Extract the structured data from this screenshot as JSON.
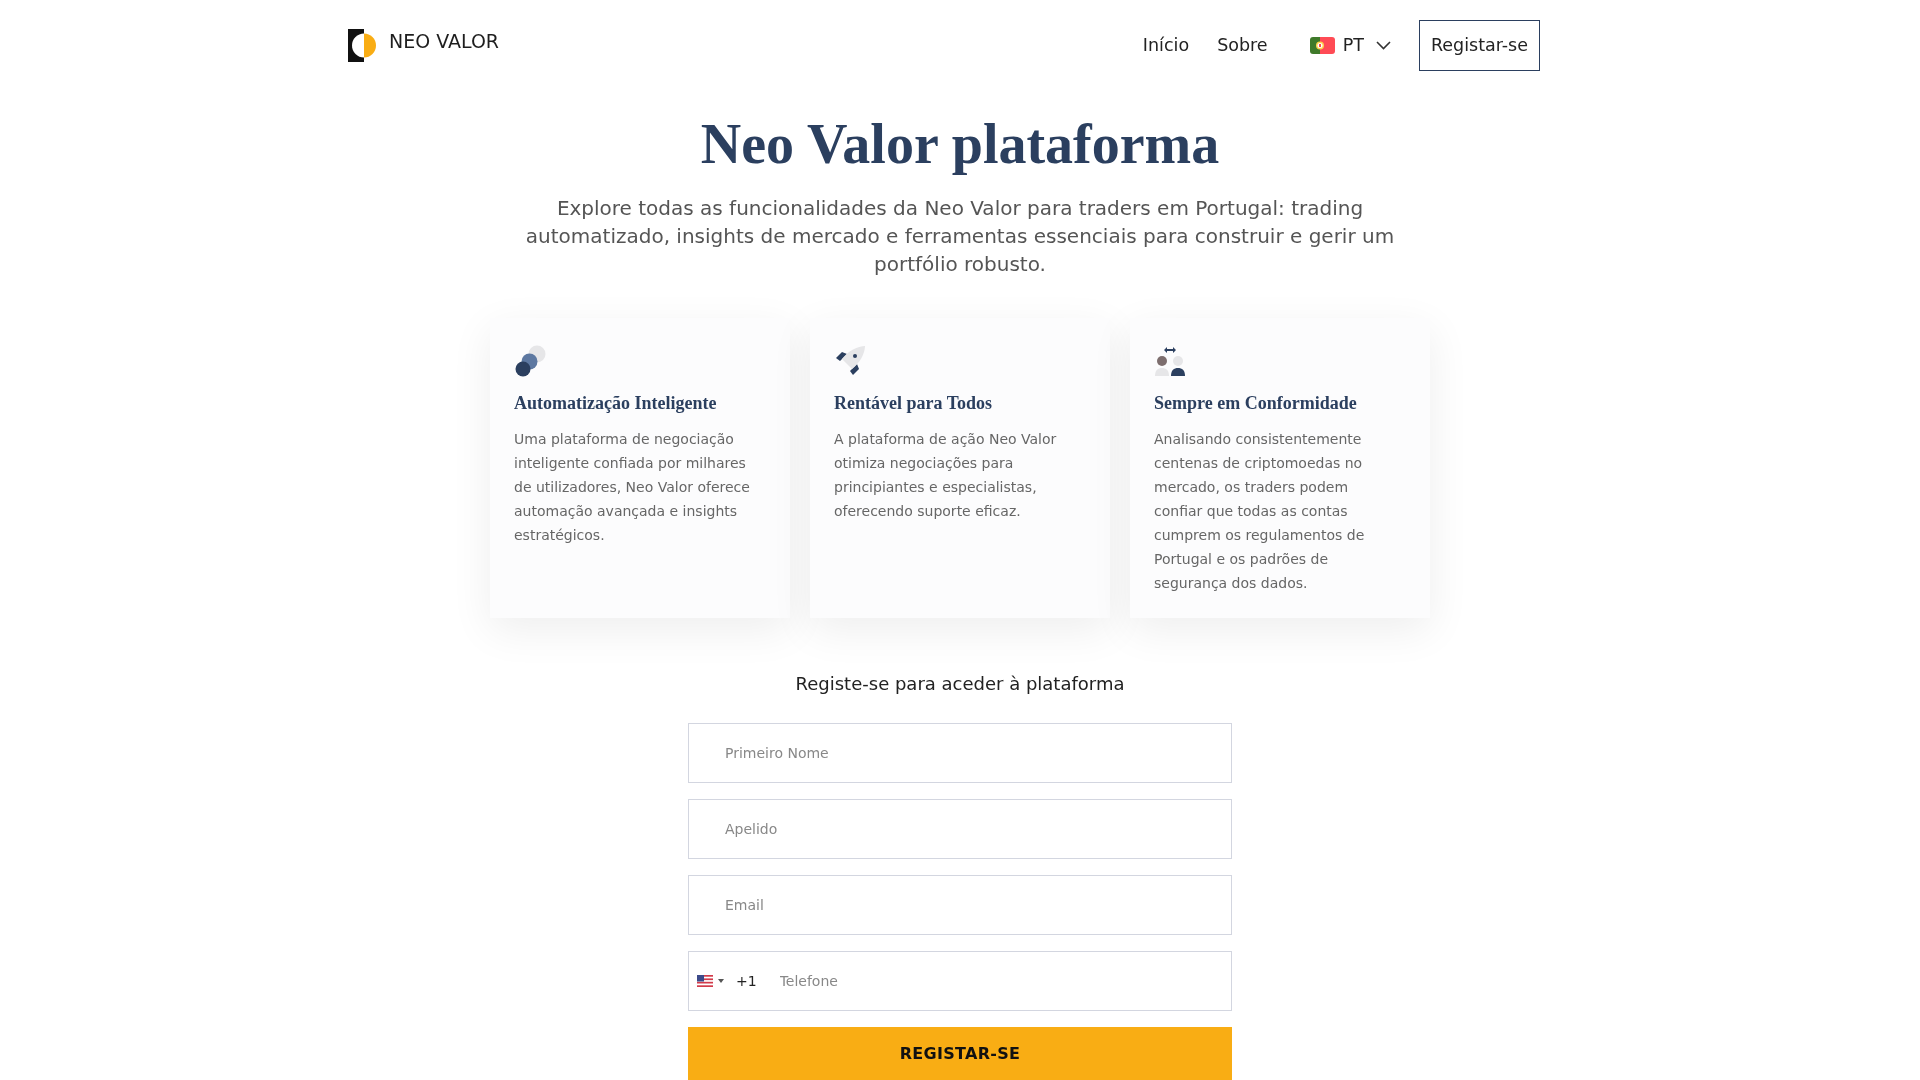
{
  "header": {
    "brand": "NEO VALOR",
    "nav": [
      {
        "label": "Início"
      },
      {
        "label": "Sobre"
      }
    ],
    "language": {
      "code": "PT"
    },
    "register_button": "Registar-se"
  },
  "hero": {
    "title": "Neo Valor plataforma",
    "subtitle": "Explore todas as funcionalidades da Neo Valor para traders em Portugal: trading automatizado, insights de mercado e ferramentas essenciais para construir e gerir um portfólio robusto."
  },
  "features": [
    {
      "title": "Automatização Inteligente",
      "description": "Uma plataforma de negociação inteligente confiada por milhares de utilizadores, Neo Valor oferece automação avançada e insights estratégicos."
    },
    {
      "title": "Rentável para Todos",
      "description": "A plataforma de ação Neo Valor otimiza negociações para principiantes e especialistas, oferecendo suporte eficaz."
    },
    {
      "title": "Sempre em Conformidade",
      "description": "Analisando consistentemente centenas de criptomoedas no mercado, os traders podem confiar que todas as contas cumprem os regulamentos de Portugal e os padrões de segurança dos dados."
    }
  ],
  "form": {
    "heading": "Registe-se para aceder à plataforma",
    "fields": [
      {
        "placeholder": "Primeiro Nome"
      },
      {
        "placeholder": "Apelido"
      },
      {
        "placeholder": "Email"
      }
    ],
    "phone": {
      "dial_code": "+1",
      "placeholder": "Telefone"
    },
    "submit_button": "REGISTAR-SE"
  }
}
